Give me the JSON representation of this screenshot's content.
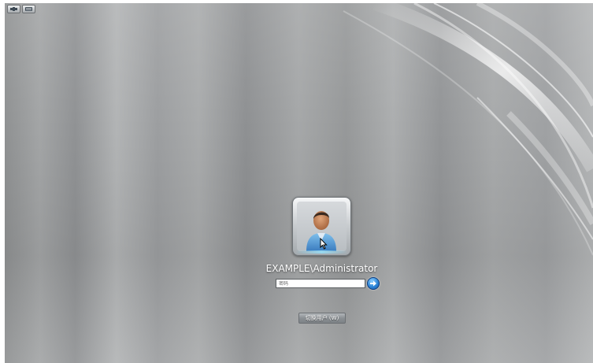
{
  "login": {
    "username": "EXAMPLE\\Administrator",
    "password_placeholder": "密码",
    "switch_user_label": "切换用户 (W)"
  },
  "icons": {
    "top_left": [
      "accessibility-icon",
      "keyboard-icon"
    ],
    "tile": "user-avatar-icon",
    "submit": "arrow-right-icon"
  },
  "colors": {
    "background": "#a0a2a4",
    "username_text": "#ffffff",
    "submit_accent": "#2d86d8"
  }
}
